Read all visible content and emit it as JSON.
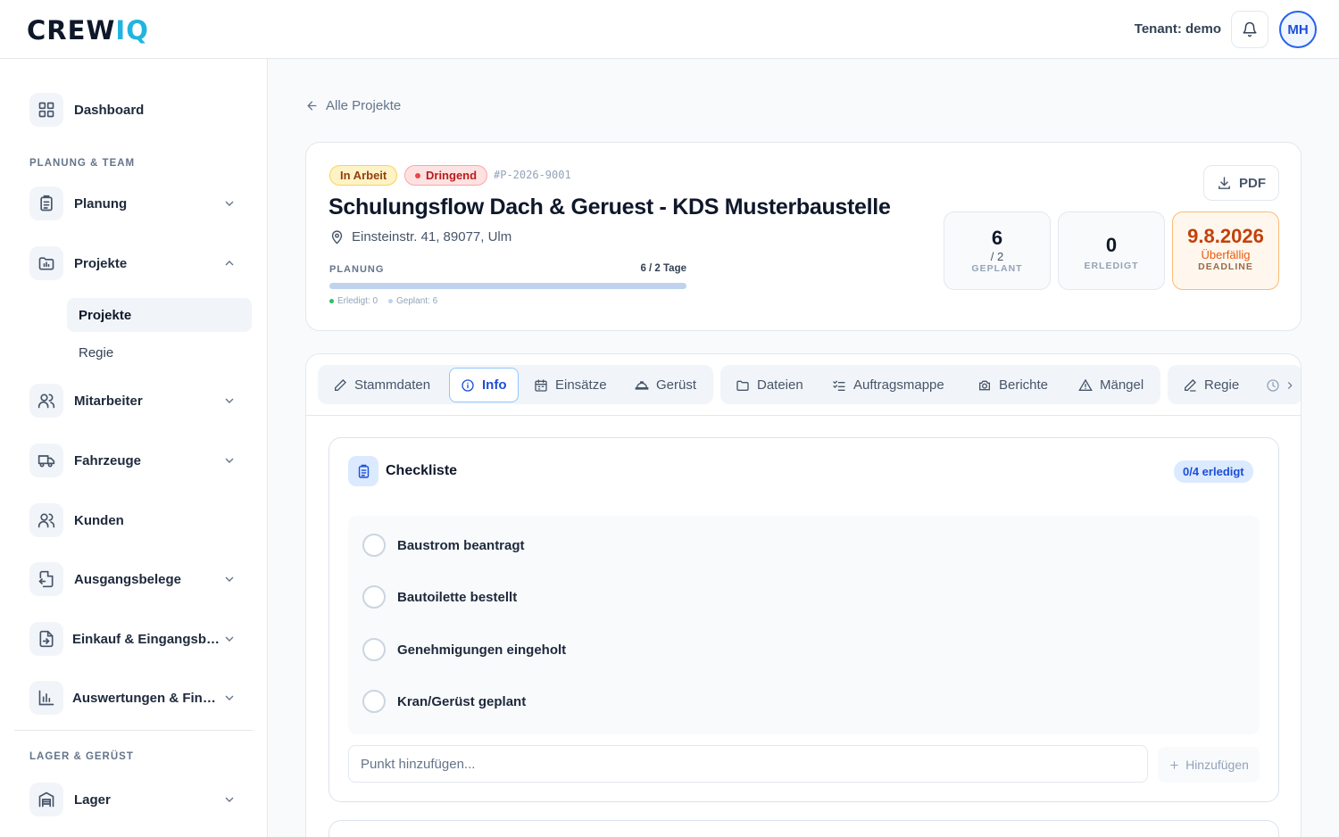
{
  "header": {
    "logo_main": "CREW",
    "logo_accent": "IQ",
    "tenant": "Tenant: demo",
    "user_initials": "MH"
  },
  "sidebar": {
    "dashboard": "Dashboard",
    "section_planning": "PLANUNG & TEAM",
    "planung": "Planung",
    "projekte": "Projekte",
    "projekte_sub": [
      "Projekte",
      "Regie"
    ],
    "mitarbeiter": "Mitarbeiter",
    "fahrzeuge": "Fahrzeuge",
    "kunden": "Kunden",
    "ausgangsbelege": "Ausgangsbelege",
    "einkauf": "Einkauf & Eingangsbelege",
    "auswertungen": "Auswertungen & Finanzen",
    "section_lager": "LAGER & GERÜST",
    "lager": "Lager"
  },
  "back_link": "Alle Projekte",
  "project": {
    "status": "In Arbeit",
    "priority": "Dringend",
    "id": "#P-2026-9001",
    "title": "Schulungsflow Dach & Geruest - KDS Musterbaustelle",
    "address": "Einsteinstr. 41, 89077, Ulm",
    "planning_label": "PLANUNG",
    "planning_days": "6 / 2 Tage",
    "planning_progress": 1.0,
    "legend_done": "Erledigt: 0",
    "legend_planned": "Geplant: 6",
    "pdf_label": "PDF",
    "stats": [
      {
        "value": "6",
        "sub": "/ 2",
        "label": "GEPLANT"
      },
      {
        "value": "0",
        "sub": "",
        "label": "ERLEDIGT"
      },
      {
        "value": "9.8.2026",
        "sub": "Überfällig",
        "label": "DEADLINE"
      }
    ]
  },
  "tabs": [
    "Stammdaten",
    "Info",
    "Einsätze",
    "Gerüst",
    "Dateien",
    "Auftragsmappe",
    "Berichte",
    "Mängel",
    "Regie"
  ],
  "active_tab": "Info",
  "checklist": {
    "title": "Checkliste",
    "count": "0/4 erledigt",
    "items": [
      "Baustrom beantragt",
      "Bautoilette bestellt",
      "Genehmigungen eingeholt",
      "Kran/Gerüst geplant"
    ],
    "input_placeholder": "Punkt hinzufügen...",
    "add_label": "Hinzufügen"
  },
  "colors": {
    "accent": "#22b4e0",
    "primary": "#2563eb",
    "overdue": "#c2410c"
  }
}
